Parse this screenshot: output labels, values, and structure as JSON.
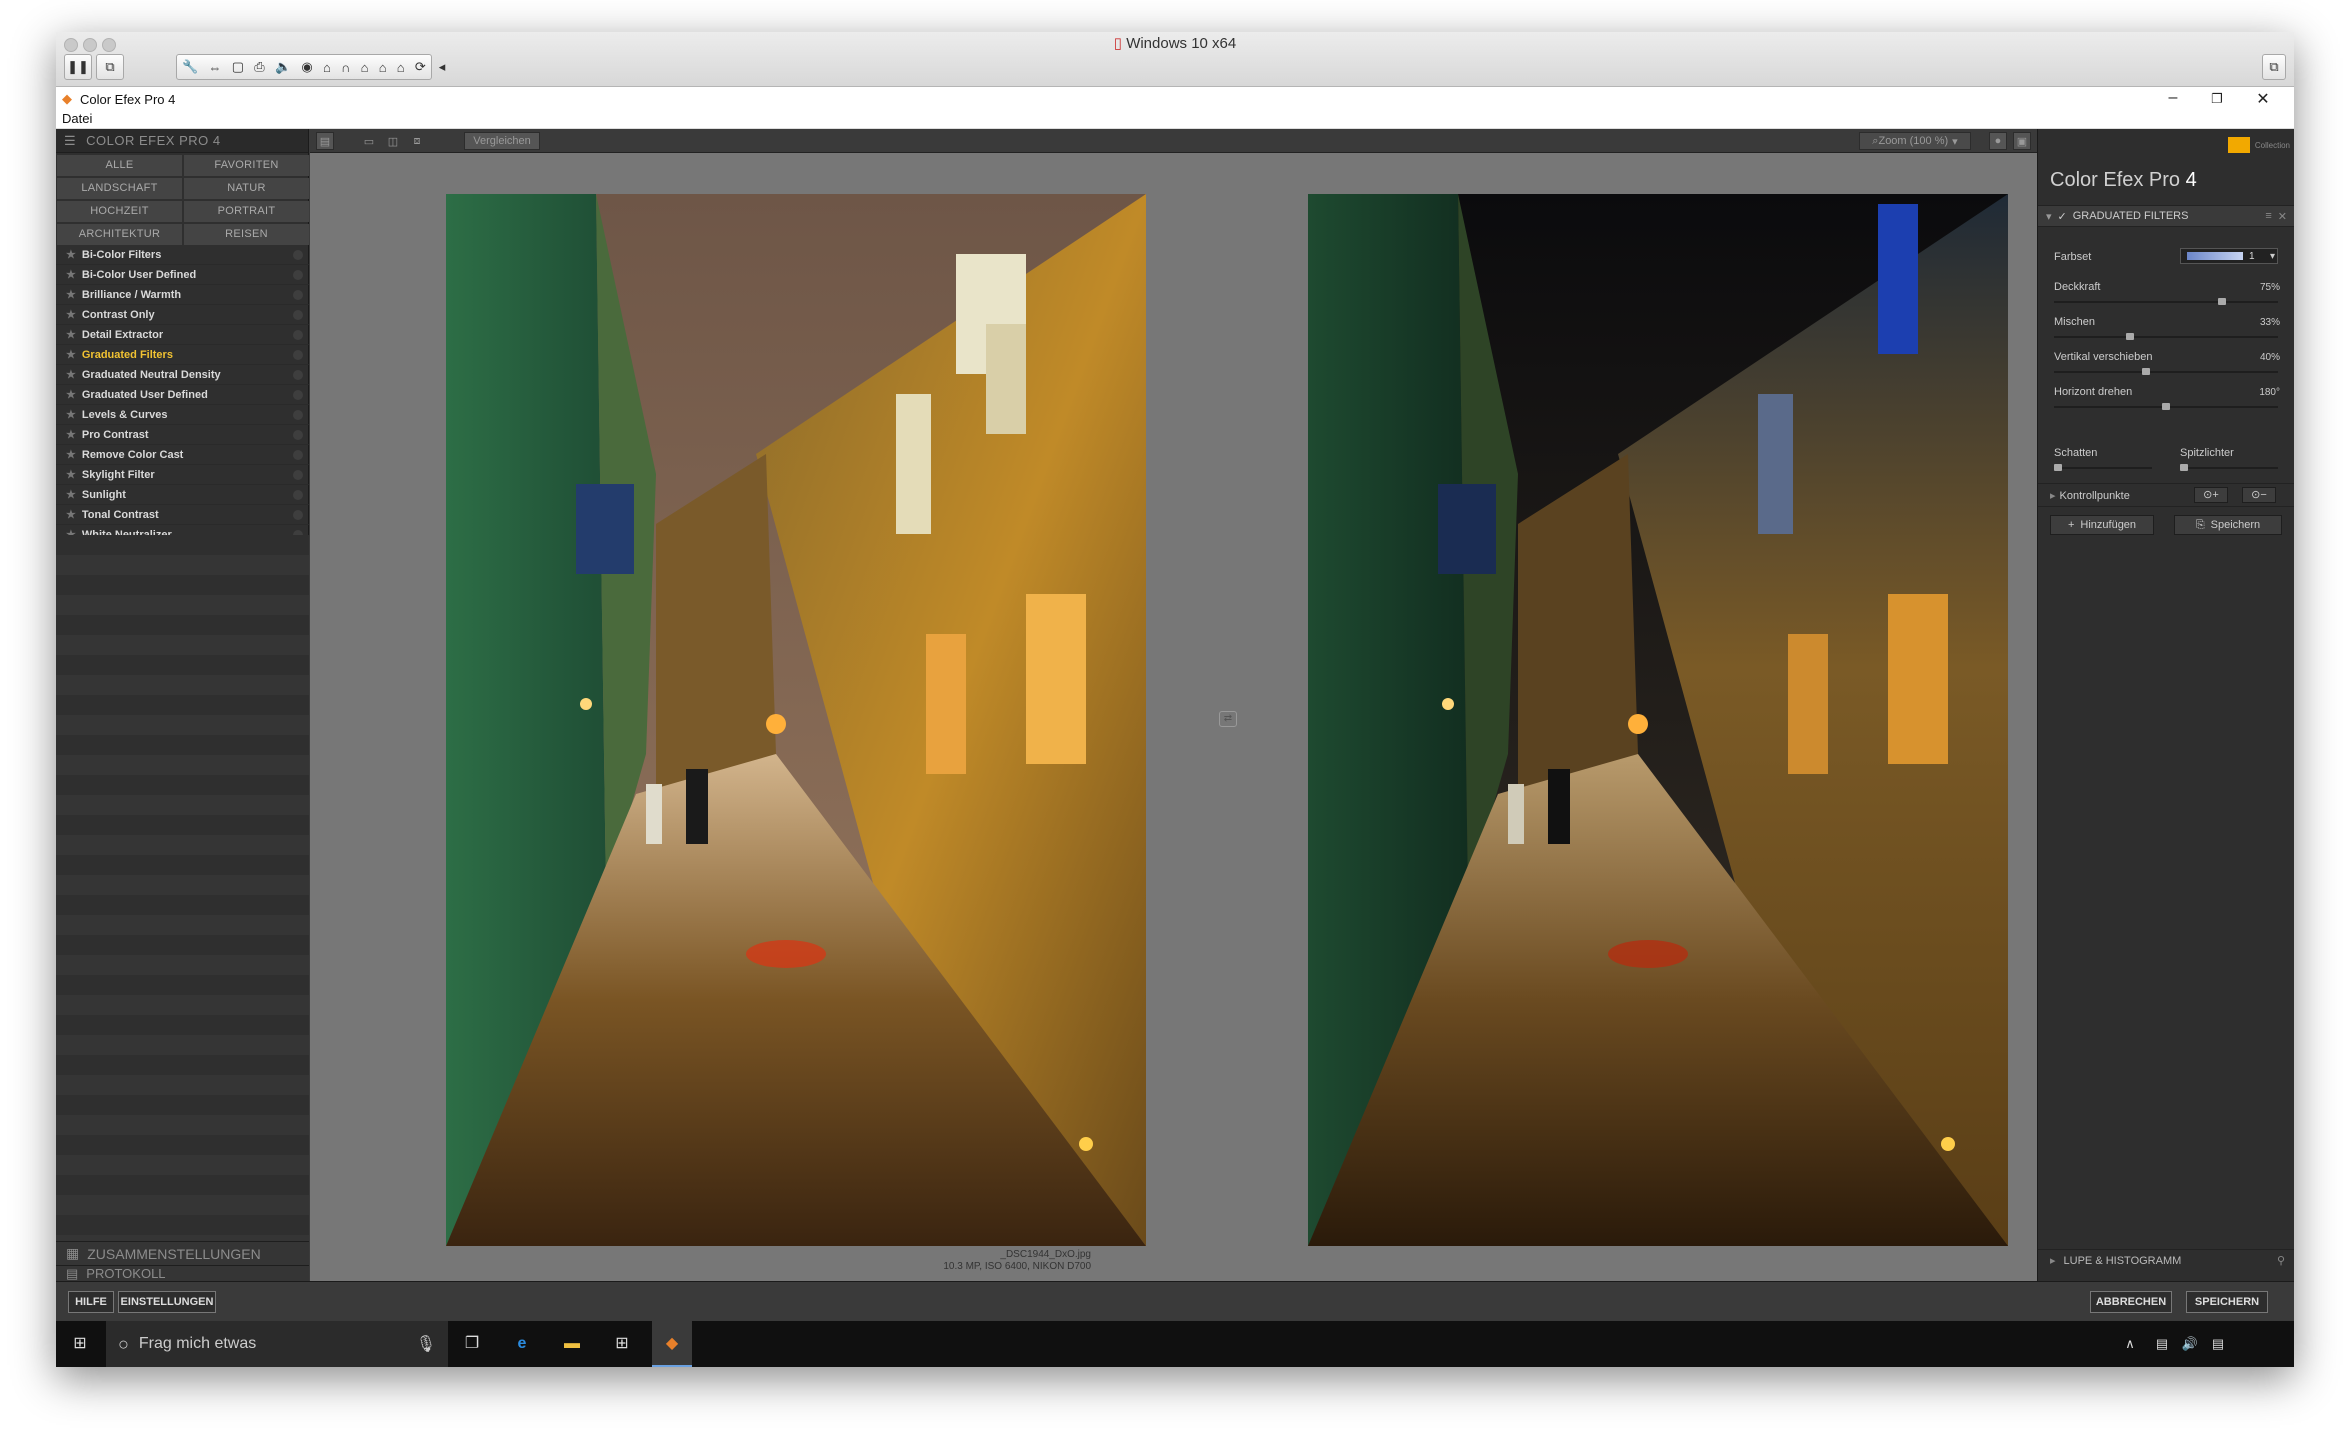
{
  "vm": {
    "title": "Windows 10 x64"
  },
  "app": {
    "title": "Color Efex Pro 4",
    "menu": "Datei"
  },
  "left": {
    "header": "COLOR EFEX PRO 4",
    "categories": [
      "ALLE",
      "FAVORITEN",
      "LANDSCHAFT",
      "NATUR",
      "HOCHZEIT",
      "PORTRAIT",
      "ARCHITEKTUR",
      "REISEN"
    ],
    "filters": [
      "Bi-Color Filters",
      "Bi-Color User Defined",
      "Brilliance / Warmth",
      "Contrast Only",
      "Detail Extractor",
      "Graduated Filters",
      "Graduated Neutral Density",
      "Graduated User Defined",
      "Levels & Curves",
      "Pro Contrast",
      "Remove Color Cast",
      "Skylight Filter",
      "Sunlight",
      "Tonal Contrast",
      "White Neutralizer"
    ],
    "selected_filter": "Graduated Filters",
    "sections": {
      "recipes": "ZUSAMMENSTELLUNGEN",
      "history": "PROTOKOLL"
    }
  },
  "toolbar": {
    "compare": "Vergleichen",
    "zoom": "Zoom (100 %)"
  },
  "image": {
    "filename": "_DSC1944_DxO.jpg",
    "meta": "10.3 MP, ISO 6400, NIKON D700"
  },
  "right": {
    "brand": "Collection",
    "title": "Color Efex Pro",
    "title_num": "4",
    "filter_name": "GRADUATED FILTERS",
    "farbset_label": "Farbset",
    "farbset_value": "1",
    "params": [
      {
        "label": "Deckkraft",
        "value": "75%",
        "pos": 0.75
      },
      {
        "label": "Mischen",
        "value": "33%",
        "pos": 0.33
      },
      {
        "label": "Vertikal verschieben",
        "value": "40%",
        "pos": 0.4
      },
      {
        "label": "Horizont drehen",
        "value": "180°",
        "pos": 0.5
      }
    ],
    "schatten": "Schatten",
    "spitzlichter": "Spitzlichter",
    "kontrollpunkte": "Kontrollpunkte",
    "add": "Hinzufügen",
    "save": "Speichern",
    "loupe": "LUPE & HISTOGRAMM"
  },
  "bottom": {
    "help": "HILFE",
    "settings": "EINSTELLUNGEN",
    "cancel": "ABBRECHEN",
    "save": "SPEICHERN"
  },
  "taskbar": {
    "search": "Frag mich etwas"
  }
}
